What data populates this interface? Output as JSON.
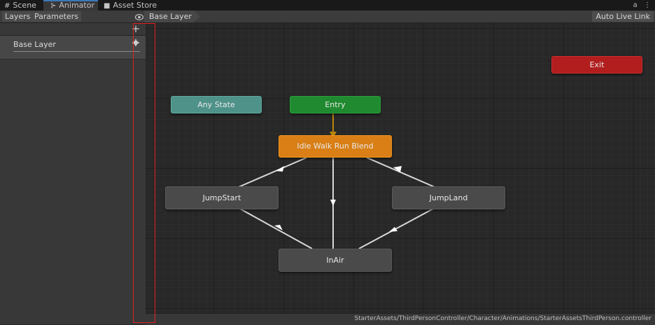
{
  "tabs": [
    {
      "label": "Scene",
      "icon": "#"
    },
    {
      "label": "Animator",
      "icon": "⊱"
    },
    {
      "label": "Asset Store",
      "icon": "■"
    }
  ],
  "window_icons": {
    "lock": "a",
    "menu": "⋮"
  },
  "toolbar": {
    "layers_tab": "Layers",
    "parameters_tab": "Parameters",
    "breadcrumb": "Base Layer",
    "auto_live_link": "Auto Live Link"
  },
  "layers_panel": {
    "add_symbol": "+",
    "layer_name": "Base Layer"
  },
  "states": {
    "exit": "Exit",
    "any_state": "Any State",
    "entry": "Entry",
    "default_state": "Idle Walk Run Blend",
    "jump_start": "JumpStart",
    "jump_land": "JumpLand",
    "in_air": "InAir"
  },
  "colors": {
    "any_state": "#4e9289",
    "entry": "#1f8a2f",
    "exit": "#b21d1d",
    "default_state": "#d97f15",
    "state": "#4a4a4a",
    "highlight": "#e02020",
    "active_tab_accent": "#3a79bb"
  },
  "status": {
    "controller_path": "StarterAssets/ThirdPersonController/Character/Animations/StarterAssetsThirdPerson.controller"
  }
}
